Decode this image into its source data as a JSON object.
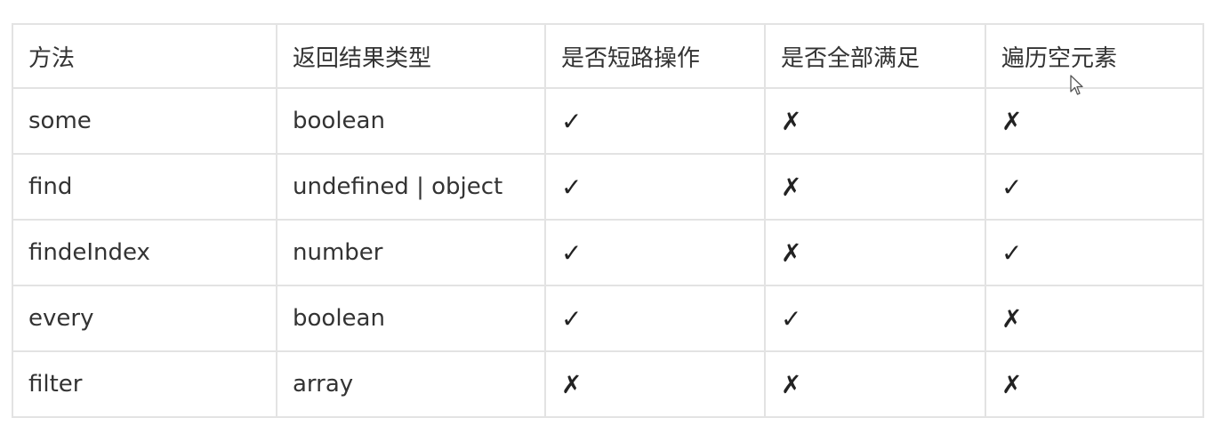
{
  "table": {
    "headers": [
      "方法",
      "返回结果类型",
      "是否短路操作",
      "是否全部满足",
      "遍历空元素"
    ],
    "rows": [
      [
        "some",
        "boolean",
        "✓",
        "✗",
        "✗"
      ],
      [
        "find",
        "undefined | object",
        "✓",
        "✗",
        "✓"
      ],
      [
        "findeIndex",
        "number",
        "✓",
        "✗",
        "✓"
      ],
      [
        "every",
        "boolean",
        "✓",
        "✓",
        "✗"
      ],
      [
        "filter",
        "array",
        "✗",
        "✗",
        "✗"
      ]
    ]
  },
  "cursor": {
    "icon": "arrow-pointer-icon"
  }
}
